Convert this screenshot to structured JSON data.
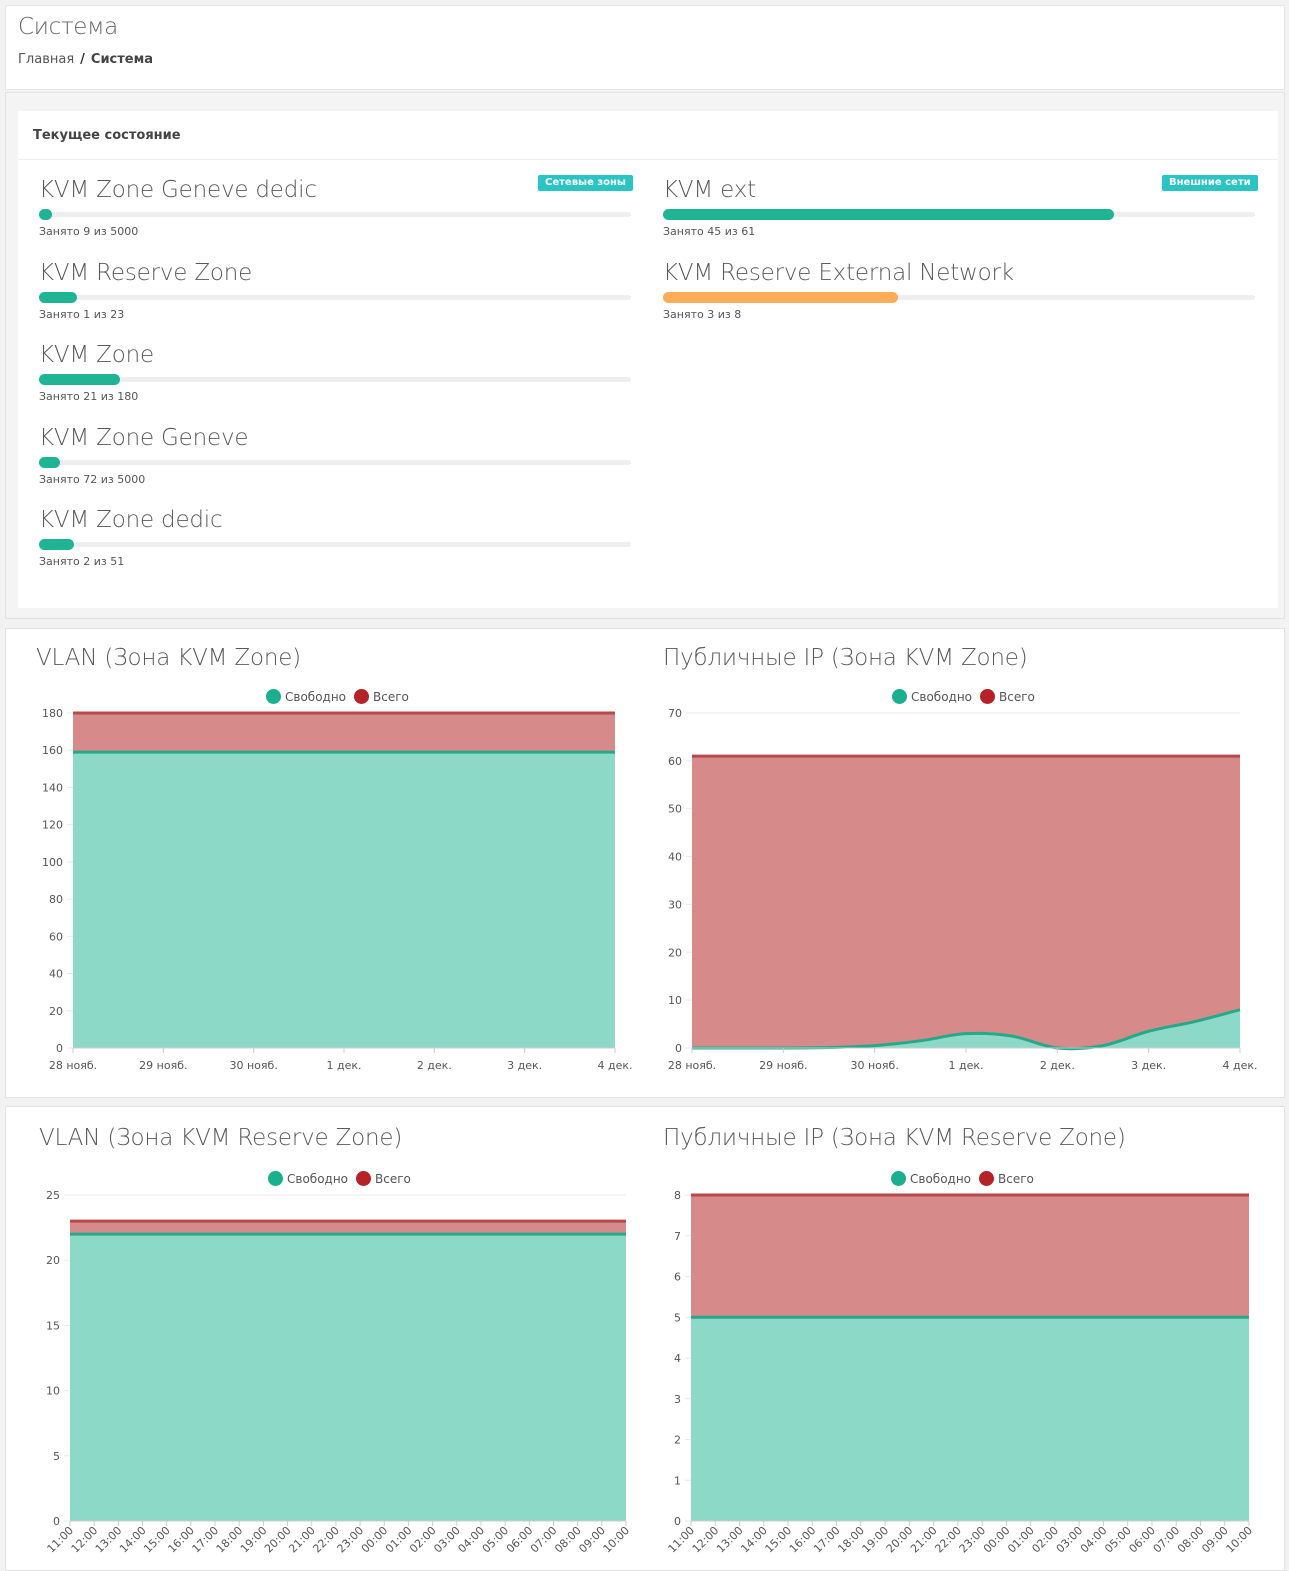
{
  "page": {
    "title": "Система",
    "breadcrumb": {
      "home": "Главная",
      "separator": "/",
      "current": "Система"
    }
  },
  "status": {
    "title": "Текущее состояние",
    "badges": {
      "left": "Сетевые зоны",
      "right": "Внешние сети"
    },
    "left": [
      {
        "name": "KVM Zone Geneve dedic",
        "text": "Занято 9 из 5000",
        "fill_fraction": 0.0018
      },
      {
        "name": "KVM Reserve Zone",
        "text": "Занято 1 из 23",
        "fill_fraction": 0.0435
      },
      {
        "name": "KVM Zone",
        "text": "Занято 21 из 180",
        "fill_fraction": 0.1167
      },
      {
        "name": "KVM Zone Geneve",
        "text": "Занято 72 из 5000",
        "fill_fraction": 0.0144
      },
      {
        "name": "KVM Zone dedic",
        "text": "Занято 2 из 51",
        "fill_fraction": 0.0392
      }
    ],
    "right": [
      {
        "name": "KVM ext",
        "text": "Занято 45 из 61",
        "fill_fraction": 0.7377,
        "color": "#1fb594"
      },
      {
        "name": "KVM Reserve External Network",
        "text": "Занято 3 из 8",
        "fill_fraction": 0.375,
        "color": "#fbad57"
      }
    ],
    "colors": {
      "bar": "#1fb594",
      "track": "#eeeeee",
      "badge": "#2bc4c4"
    }
  },
  "legend": {
    "free": "Свободно",
    "total": "Всего",
    "free_color": "#1aaf8d",
    "total_color": "#b52227"
  },
  "charts": [
    {
      "title": "VLAN (Зона KVM Zone)",
      "chart_data": {
        "type": "area",
        "xlabels": [
          "28 нояб.",
          "29 нояб.",
          "30 нояб.",
          "1 дек.",
          "2 дек.",
          "3 дек.",
          "4 дек."
        ],
        "yticks": [
          0,
          20,
          40,
          60,
          80,
          100,
          120,
          140,
          160,
          180
        ],
        "ylim": [
          0,
          180
        ],
        "series": [
          {
            "name": "Свободно",
            "x": [
              0,
              6
            ],
            "y": [
              159,
              159
            ]
          },
          {
            "name": "Всего",
            "x": [
              0,
              6
            ],
            "y": [
              180,
              180
            ]
          }
        ]
      }
    },
    {
      "title": "Публичные IP (Зона KVM Zone)",
      "chart_data": {
        "type": "area",
        "xlabels": [
          "28 нояб.",
          "29 нояб.",
          "30 нояб.",
          "1 дек.",
          "2 дек.",
          "3 дек.",
          "4 дек."
        ],
        "yticks": [
          0,
          10,
          20,
          30,
          40,
          50,
          60,
          70
        ],
        "ylim": [
          0,
          70
        ],
        "series": [
          {
            "name": "Свободно",
            "x": [
              0,
              1,
              1.5,
              2,
              2.5,
              3,
              3.5,
              4,
              4.5,
              5,
              5.5,
              6
            ],
            "y": [
              0,
              0,
              0.1,
              0.5,
              1.5,
              3,
              2.5,
              0,
              0.5,
              3.5,
              5.5,
              8
            ]
          },
          {
            "name": "Всего",
            "x": [
              0,
              6
            ],
            "y": [
              61,
              61
            ]
          }
        ]
      }
    },
    {
      "title": "VLAN (Зона KVM Reserve Zone)",
      "chart_data": {
        "type": "area",
        "xlabels": [
          "11:00",
          "12:00",
          "13:00",
          "14:00",
          "15:00",
          "16:00",
          "17:00",
          "18:00",
          "19:00",
          "20:00",
          "21:00",
          "22:00",
          "23:00",
          "00:00",
          "01:00",
          "02:00",
          "03:00",
          "04:00",
          "05:00",
          "06:00",
          "07:00",
          "08:00",
          "09:00",
          "10:00"
        ],
        "yticks": [
          0,
          5,
          10,
          15,
          20,
          25
        ],
        "ylim": [
          0,
          25
        ],
        "series": [
          {
            "name": "Свободно",
            "x": [
              0,
              23
            ],
            "y": [
              22,
              22
            ]
          },
          {
            "name": "Всего",
            "x": [
              0,
              23
            ],
            "y": [
              23,
              23
            ]
          }
        ]
      }
    },
    {
      "title": "Публичные IP (Зона KVM Reserve Zone)",
      "chart_data": {
        "type": "area",
        "xlabels": [
          "11:00",
          "12:00",
          "13:00",
          "14:00",
          "15:00",
          "16:00",
          "17:00",
          "18:00",
          "19:00",
          "20:00",
          "21:00",
          "22:00",
          "23:00",
          "00:00",
          "01:00",
          "02:00",
          "03:00",
          "04:00",
          "05:00",
          "06:00",
          "07:00",
          "08:00",
          "09:00",
          "10:00"
        ],
        "yticks": [
          0,
          1,
          2,
          3,
          4,
          5,
          6,
          7,
          8
        ],
        "ylim": [
          0,
          8
        ],
        "series": [
          {
            "name": "Свободно",
            "x": [
              0,
              23
            ],
            "y": [
              5,
              5
            ]
          },
          {
            "name": "Всего",
            "x": [
              0,
              23
            ],
            "y": [
              8,
              8
            ]
          }
        ]
      }
    }
  ],
  "chart_colors": {
    "free_fill": "#8cd9c8",
    "free_line": "#26a98b",
    "total_fill": "#d68a8a",
    "total_line": "#b8484b",
    "grid": "#e8e8e8",
    "axis": "#cccccc"
  }
}
